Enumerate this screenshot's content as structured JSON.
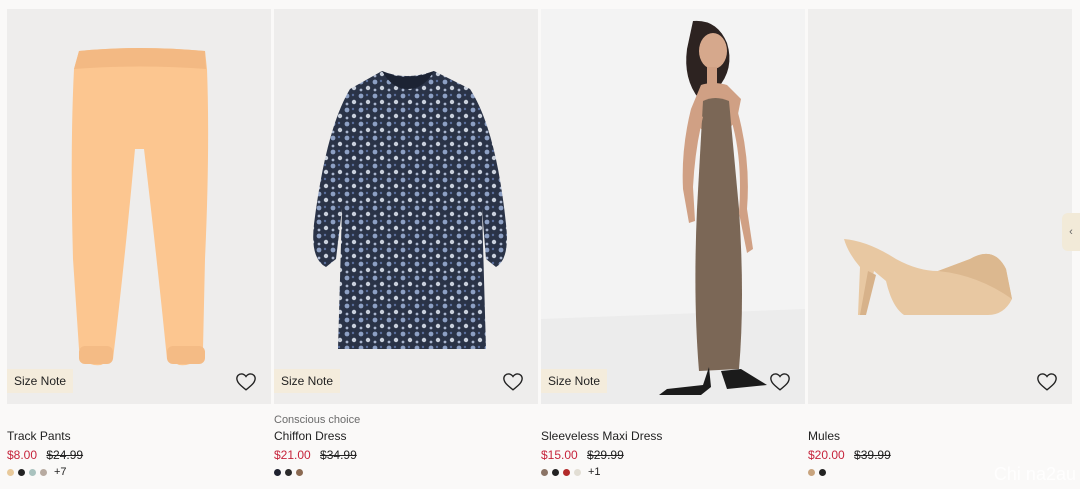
{
  "products": [
    {
      "label": "",
      "title": "Track Pants",
      "sale_price": "$8.00",
      "original_price": "$24.99",
      "size_note": "Size Note",
      "swatches": [
        "#e8c99a",
        "#222222",
        "#a9c2be",
        "#b7aaa0"
      ],
      "more_colors": "+7"
    },
    {
      "label": "Conscious choice",
      "title": "Chiffon Dress",
      "sale_price": "$21.00",
      "original_price": "$34.99",
      "size_note": "Size Note",
      "swatches": [
        "#1f2230",
        "#2b2b2b",
        "#8b6a52"
      ],
      "more_colors": ""
    },
    {
      "label": "",
      "title": "Sleeveless Maxi Dress",
      "sale_price": "$15.00",
      "original_price": "$29.99",
      "size_note": "Size Note",
      "swatches": [
        "#8b7466",
        "#222222",
        "#b22a2a",
        "#e2ded4"
      ],
      "more_colors": "+1"
    },
    {
      "label": "",
      "title": "Mules",
      "sale_price": "$20.00",
      "original_price": "$39.99",
      "size_note": "",
      "swatches": [
        "#c8a47e",
        "#222222"
      ],
      "more_colors": ""
    }
  ],
  "icons": {
    "favorite": "heart-outline-icon",
    "next": "chevron-right-icon"
  },
  "watermark": "Chi na2au"
}
